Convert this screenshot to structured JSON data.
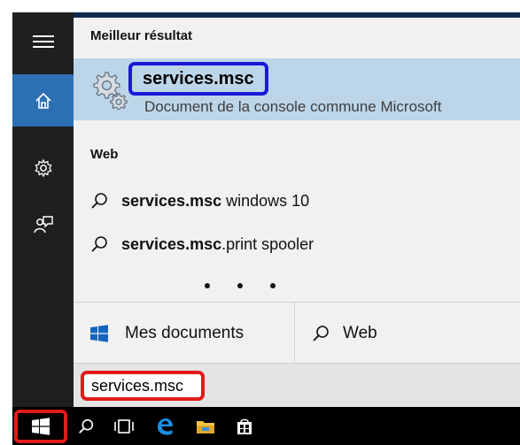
{
  "panel": {
    "best_result_title": "Meilleur résultat",
    "best_result": {
      "name": "services.msc",
      "description": "Document de la console commune Microsoft",
      "icon": "gears-icon"
    },
    "web_title": "Web",
    "web_suggestions": [
      {
        "bold": "services.msc",
        "rest": " windows 10"
      },
      {
        "bold": "services.msc",
        "rest": ".print spooler"
      }
    ],
    "more_indicator": "• • •"
  },
  "tabs": {
    "documents": "Mes documents",
    "web": "Web"
  },
  "search_bar": {
    "value": "services.msc"
  },
  "left_rail": {
    "items": [
      "menu-icon",
      "home-icon",
      "settings-icon",
      "feedback-icon"
    ]
  },
  "taskbar": {
    "items": [
      "windows-start-icon",
      "search-icon",
      "task-view-icon",
      "edge-icon",
      "file-explorer-icon",
      "store-icon"
    ]
  },
  "colors": {
    "accent": "#2d6fb3",
    "highlight_blue": "#1b18d6",
    "highlight_red": "#e21b1b",
    "best_result_bg": "#bcd5e8"
  }
}
